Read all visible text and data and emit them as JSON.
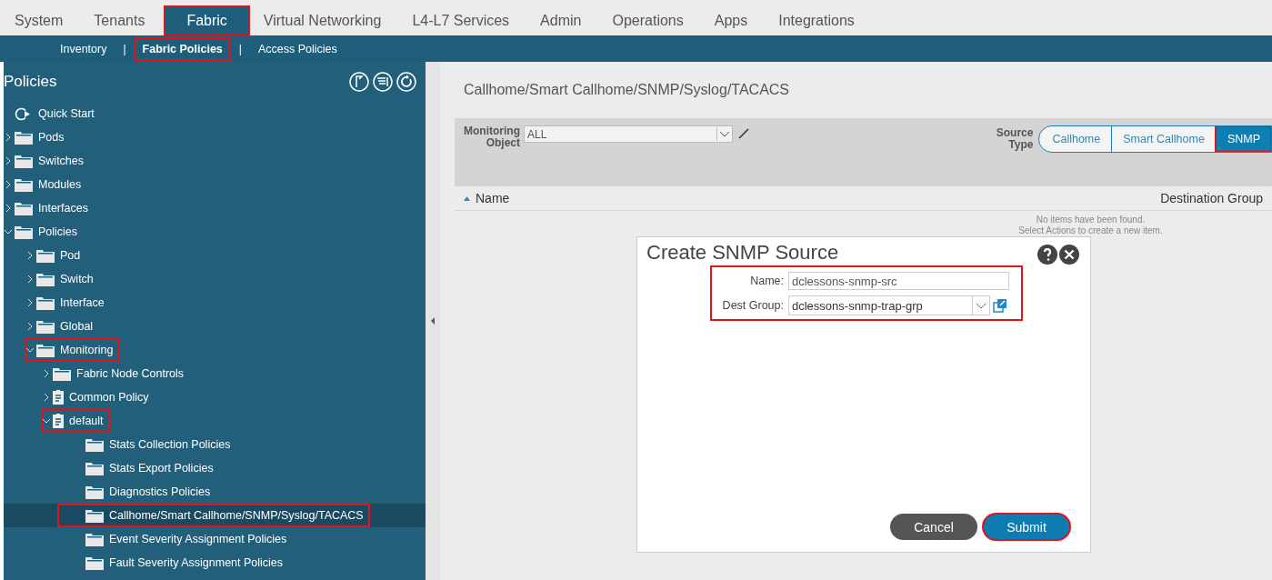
{
  "top_tabs": [
    {
      "label": "System",
      "selected": false,
      "highlighted": false
    },
    {
      "label": "Tenants",
      "selected": false,
      "highlighted": false
    },
    {
      "label": "Fabric",
      "selected": true,
      "highlighted": true
    },
    {
      "label": "Virtual Networking",
      "selected": false,
      "highlighted": false
    },
    {
      "label": "L4-L7 Services",
      "selected": false,
      "highlighted": false
    },
    {
      "label": "Admin",
      "selected": false,
      "highlighted": false
    },
    {
      "label": "Operations",
      "selected": false,
      "highlighted": false
    },
    {
      "label": "Apps",
      "selected": false,
      "highlighted": false
    },
    {
      "label": "Integrations",
      "selected": false,
      "highlighted": false
    }
  ],
  "sub_tabs": [
    {
      "label": "Inventory",
      "selected": false,
      "highlighted": false
    },
    {
      "label": "Fabric Policies",
      "selected": true,
      "highlighted": true
    },
    {
      "label": "Access Policies",
      "selected": false,
      "highlighted": false
    }
  ],
  "sub_separator": "|",
  "sidebar": {
    "title": "Policies",
    "items": [
      {
        "label": "Quick Start",
        "kind": "quickstart",
        "selected": false,
        "highlighted": false
      },
      {
        "label": "Pods",
        "kind": "folder",
        "expanded": false,
        "selected": false,
        "highlighted": false
      },
      {
        "label": "Switches",
        "kind": "folder",
        "expanded": false,
        "selected": false,
        "highlighted": false
      },
      {
        "label": "Modules",
        "kind": "folder",
        "expanded": false,
        "selected": false,
        "highlighted": false
      },
      {
        "label": "Interfaces",
        "kind": "folder",
        "expanded": false,
        "selected": false,
        "highlighted": false
      },
      {
        "label": "Policies",
        "kind": "folder",
        "expanded": true,
        "selected": false,
        "highlighted": false,
        "children": [
          {
            "label": "Pod",
            "kind": "folder",
            "expanded": false,
            "selected": false,
            "highlighted": false
          },
          {
            "label": "Switch",
            "kind": "folder",
            "expanded": false,
            "selected": false,
            "highlighted": false
          },
          {
            "label": "Interface",
            "kind": "folder",
            "expanded": false,
            "selected": false,
            "highlighted": false
          },
          {
            "label": "Global",
            "kind": "folder",
            "expanded": false,
            "selected": false,
            "highlighted": false
          },
          {
            "label": "Monitoring",
            "kind": "folder",
            "expanded": true,
            "selected": false,
            "highlighted": true,
            "children": [
              {
                "label": "Fabric Node Controls",
                "kind": "folder",
                "expanded": false,
                "selected": false,
                "highlighted": false
              },
              {
                "label": "Common Policy",
                "kind": "document",
                "expanded": false,
                "selected": false,
                "highlighted": false
              },
              {
                "label": "default",
                "kind": "document",
                "expanded": true,
                "selected": false,
                "highlighted": true,
                "children": [
                  {
                    "label": "Stats Collection Policies",
                    "kind": "folder",
                    "selected": false,
                    "highlighted": false
                  },
                  {
                    "label": "Stats Export Policies",
                    "kind": "folder",
                    "selected": false,
                    "highlighted": false
                  },
                  {
                    "label": "Diagnostics Policies",
                    "kind": "folder",
                    "selected": false,
                    "highlighted": false
                  },
                  {
                    "label": "Callhome/Smart Callhome/SNMP/Syslog/TACACS",
                    "kind": "folder",
                    "selected": true,
                    "highlighted": true
                  },
                  {
                    "label": "Event Severity Assignment Policies",
                    "kind": "folder",
                    "selected": false,
                    "highlighted": false
                  },
                  {
                    "label": "Fault Severity Assignment Policies",
                    "kind": "folder",
                    "selected": false,
                    "highlighted": false
                  }
                ]
              }
            ]
          }
        ]
      }
    ]
  },
  "content": {
    "title": "Callhome/Smart Callhome/SNMP/Syslog/TACACS",
    "monitoring_object": {
      "label_lines": [
        "Monitoring",
        "Object"
      ],
      "value": "ALL"
    },
    "source_type": {
      "label_lines": [
        "Source",
        "Type"
      ],
      "options": [
        {
          "label": "Callhome",
          "selected": false,
          "highlighted": false
        },
        {
          "label": "Smart Callhome",
          "selected": false,
          "highlighted": false
        },
        {
          "label": "SNMP",
          "selected": true,
          "highlighted": true
        }
      ]
    },
    "table": {
      "columns": [
        {
          "label": "Name",
          "sorted": true
        },
        {
          "label": "Destination Group",
          "sorted": false
        }
      ],
      "empty_lines": [
        "No items have been found.",
        "Select Actions to create a new item."
      ]
    }
  },
  "dialog": {
    "title": "Create SNMP Source",
    "fields_highlighted": true,
    "fields": [
      {
        "label": "Name:",
        "value": "dclessons-snmp-src",
        "kind": "text"
      },
      {
        "label": "Dest Group:",
        "value": "dclessons-snmp-trap-grp",
        "kind": "select"
      }
    ],
    "buttons": [
      {
        "label": "Cancel",
        "kind": "secondary",
        "highlighted": false
      },
      {
        "label": "Submit",
        "kind": "primary",
        "highlighted": true
      }
    ]
  }
}
